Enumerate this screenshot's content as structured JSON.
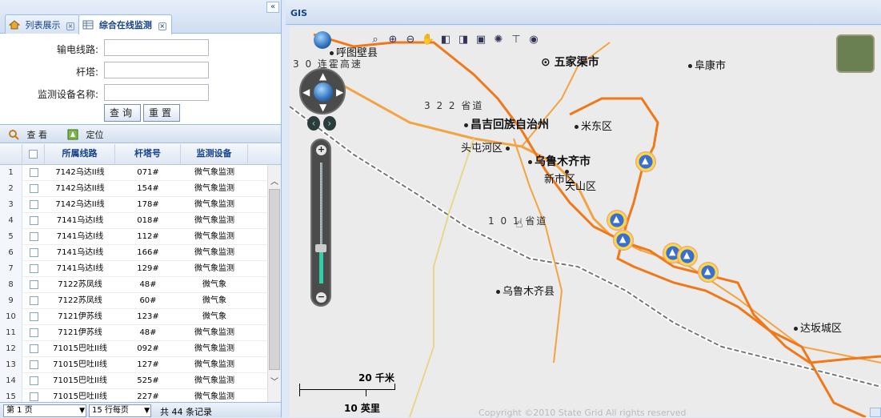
{
  "tabs": [
    {
      "label": "列表展示",
      "icon": "home-icon",
      "close": "×"
    },
    {
      "label": "综合在线监测",
      "icon": "grid-icon",
      "close": "×"
    }
  ],
  "collapse_label": "«",
  "form": {
    "line_label": "输电线路:",
    "tower_label": "杆塔:",
    "device_label": "监测设备名称:",
    "line_value": "",
    "tower_value": "",
    "device_value": "",
    "query_button": "查询",
    "reset_button": "重置"
  },
  "toolbar": {
    "view_label": "查 看",
    "locate_label": "定位"
  },
  "grid": {
    "headers": [
      "所属线路",
      "杆塔号",
      "监测设备"
    ],
    "rows": [
      {
        "n": "1",
        "line": "7142乌达II线",
        "tower": "071#",
        "device": "微气象监测"
      },
      {
        "n": "2",
        "line": "7142乌达II线",
        "tower": "154#",
        "device": "微气象监测"
      },
      {
        "n": "3",
        "line": "7142乌达II线",
        "tower": "178#",
        "device": "微气象监测"
      },
      {
        "n": "4",
        "line": "7141乌达I线",
        "tower": "018#",
        "device": "微气象监测"
      },
      {
        "n": "5",
        "line": "7141乌达I线",
        "tower": "112#",
        "device": "微气象监测"
      },
      {
        "n": "6",
        "line": "7141乌达I线",
        "tower": "166#",
        "device": "微气象监测"
      },
      {
        "n": "7",
        "line": "7141乌达I线",
        "tower": "129#",
        "device": "微气象监测"
      },
      {
        "n": "8",
        "line": "7122苏凤线",
        "tower": "48#",
        "device": "微气象"
      },
      {
        "n": "9",
        "line": "7122苏凤线",
        "tower": "60#",
        "device": "微气象"
      },
      {
        "n": "10",
        "line": "7121伊苏线",
        "tower": "123#",
        "device": "微气象"
      },
      {
        "n": "11",
        "line": "7121伊苏线",
        "tower": "48#",
        "device": "微气象监测"
      },
      {
        "n": "12",
        "line": "71015巴吐II线",
        "tower": "092#",
        "device": "微气象监测"
      },
      {
        "n": "13",
        "line": "71015巴吐II线",
        "tower": "127#",
        "device": "微气象监测"
      },
      {
        "n": "14",
        "line": "71015巴吐II线",
        "tower": "525#",
        "device": "微气象监测"
      },
      {
        "n": "15",
        "line": "71015巴吐II线",
        "tower": "227#",
        "device": "微气象监测"
      }
    ]
  },
  "pager": {
    "page_select": "第 1 页",
    "rows_select": "15 行每页",
    "total": "共 44 条记录"
  },
  "gis": {
    "title": "GIS",
    "copyright": "Copyright ©2010 State Grid All rights reserved",
    "scale_km": "20 千米",
    "scale_mi": "10 英里",
    "labels": {
      "hutubi": "呼图壁县",
      "hwy": "3 0 连霍高速",
      "wujiaqu": "五家渠市",
      "fukang": "阜康市",
      "sheng": "3 2 2 省道",
      "changji": "昌吉回族自治州",
      "midong": "米东区",
      "toutunhe": "头屯河区",
      "urumqi": "乌鲁木齐市",
      "xinshi": "新市区",
      "tianshan": "天山区",
      "guodao": "1 0 1 省道",
      "wlmqx": "乌鲁木齐县",
      "dabancheng": "达坂城区"
    }
  }
}
